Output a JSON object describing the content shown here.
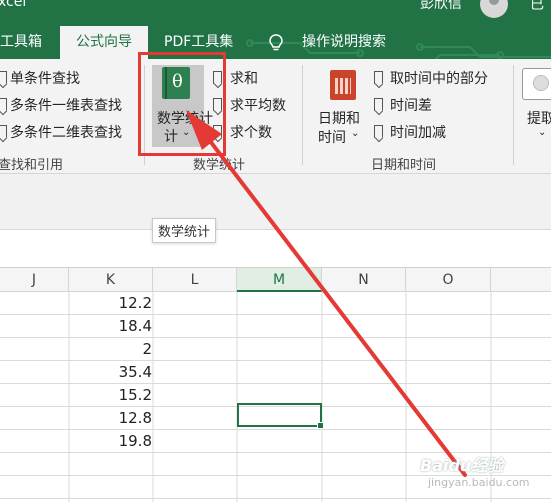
{
  "titlebar": {
    "app_title": "xcel",
    "user_name": "彭欣信",
    "mini_label": "已"
  },
  "tabs": [
    {
      "label": "工具箱"
    },
    {
      "label": "公式向导"
    },
    {
      "label": "PDF工具集"
    },
    {
      "label": "操作说明搜索"
    }
  ],
  "ribbon": {
    "lookup": {
      "items": [
        "单条件查找",
        "多条件一维表查找",
        "多条件二维表查找"
      ],
      "group_label": "查找和引用"
    },
    "math": {
      "big_button_line1": "数学统计",
      "big_button_line2": "计",
      "items": [
        "求和",
        "求平均数",
        "求个数"
      ],
      "group_label": "数学统计"
    },
    "datetime": {
      "big_button_line1": "日期和",
      "big_button_line2": "时间",
      "items": [
        "取时间中的部分",
        "时间差",
        "时间加减"
      ],
      "group_label": "日期和时间"
    },
    "extract": {
      "label": "提取"
    }
  },
  "tooltip": {
    "text": "数学统计"
  },
  "columns": [
    "J",
    "K",
    "L",
    "M",
    "N",
    "O"
  ],
  "column_K_values": [
    "12.2",
    "18.4",
    "2",
    "35.4",
    "15.2",
    "12.8",
    "19.8"
  ],
  "colors": {
    "accent": "#217346",
    "annotation": "#e53935",
    "ribbon_bg": "#f3f3f3"
  },
  "watermark": {
    "brand": "Baidu经验",
    "domain": "jingyan.baidu.com"
  }
}
